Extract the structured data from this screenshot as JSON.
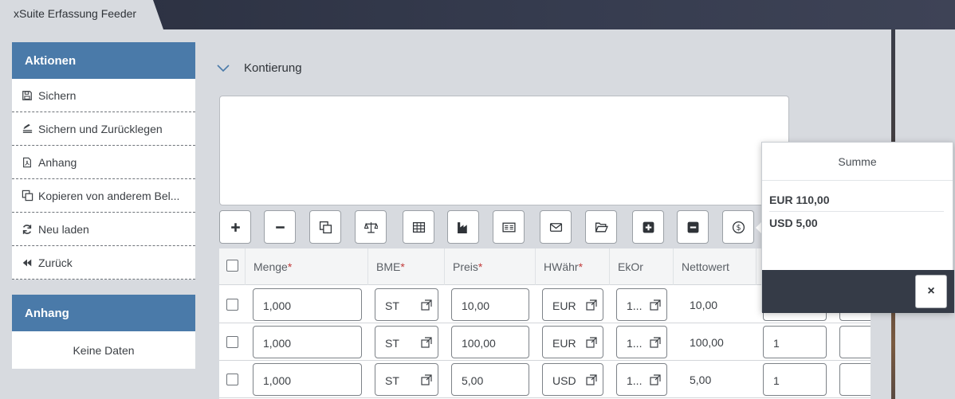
{
  "app": {
    "title": "xSuite Erfassung Feeder"
  },
  "actions": {
    "header": "Aktionen",
    "items": [
      {
        "label": "Sichern",
        "icon": "save-icon"
      },
      {
        "label": "Sichern und Zurücklegen",
        "icon": "stack-save-icon"
      },
      {
        "label": "Anhang",
        "icon": "pdf-file-icon"
      },
      {
        "label": "Kopieren von anderem Bel...",
        "icon": "copy-icon"
      },
      {
        "label": "Neu laden",
        "icon": "refresh-icon"
      },
      {
        "label": "Zurück",
        "icon": "back-icon"
      }
    ]
  },
  "attachment": {
    "header": "Anhang",
    "empty": "Keine Daten"
  },
  "section": {
    "title": "Kontierung"
  },
  "toolbar": {
    "buttons": [
      "plus-icon",
      "minus-icon",
      "copy-icon",
      "scale-icon",
      "table-icon",
      "factory-icon",
      "card-icon",
      "mail-icon",
      "folder-open-icon",
      "square-plus-icon",
      "square-minus-icon",
      "dollar-icon"
    ]
  },
  "grid": {
    "columns": [
      {
        "label": "Menge",
        "required": "*"
      },
      {
        "label": "BME",
        "required": "*"
      },
      {
        "label": "Preis",
        "required": "*"
      },
      {
        "label": "HWähr",
        "required": "*"
      },
      {
        "label": "EkOr",
        "required": ""
      },
      {
        "label": "Nettowert",
        "required": ""
      }
    ],
    "rows": [
      {
        "menge": "1,000",
        "bme": "ST",
        "preis": "10,00",
        "currency": "EUR",
        "ekor": "1...",
        "netto": "10,00",
        "extra": ""
      },
      {
        "menge": "1,000",
        "bme": "ST",
        "preis": "100,00",
        "currency": "EUR",
        "ekor": "1...",
        "netto": "100,00",
        "extra": "1"
      },
      {
        "menge": "1,000",
        "bme": "ST",
        "preis": "5,00",
        "currency": "USD",
        "ekor": "1...",
        "netto": "5,00",
        "extra": "1"
      }
    ]
  },
  "summary": {
    "title": "Summe",
    "lines": [
      "EUR 110,00",
      "USD 5,00"
    ],
    "close": "×"
  }
}
